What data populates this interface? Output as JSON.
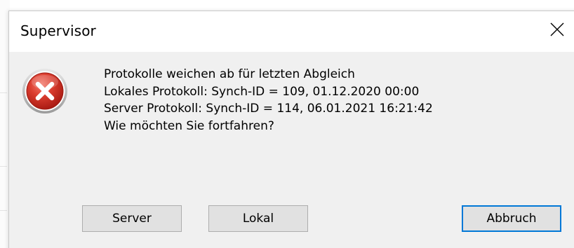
{
  "window": {
    "title": "Supervisor",
    "close_icon": "close-icon"
  },
  "message": {
    "icon": "error-icon",
    "lines": [
      "Protokolle weichen ab für letzten Abgleich",
      "Lokales Protokoll: Synch-ID = 109, 01.12.2020 00:00",
      "Server Protokoll: Synch-ID = 114, 06.01.2021 16:21:42",
      "Wie möchten Sie fortfahren?"
    ]
  },
  "buttons": {
    "server": "Server",
    "lokal": "Lokal",
    "abbruch": "Abbruch"
  },
  "colors": {
    "error_red": "#c42b1c",
    "focus_blue": "#0078d7",
    "button_face": "#e1e1e1",
    "content_background": "#f0f0f0"
  }
}
